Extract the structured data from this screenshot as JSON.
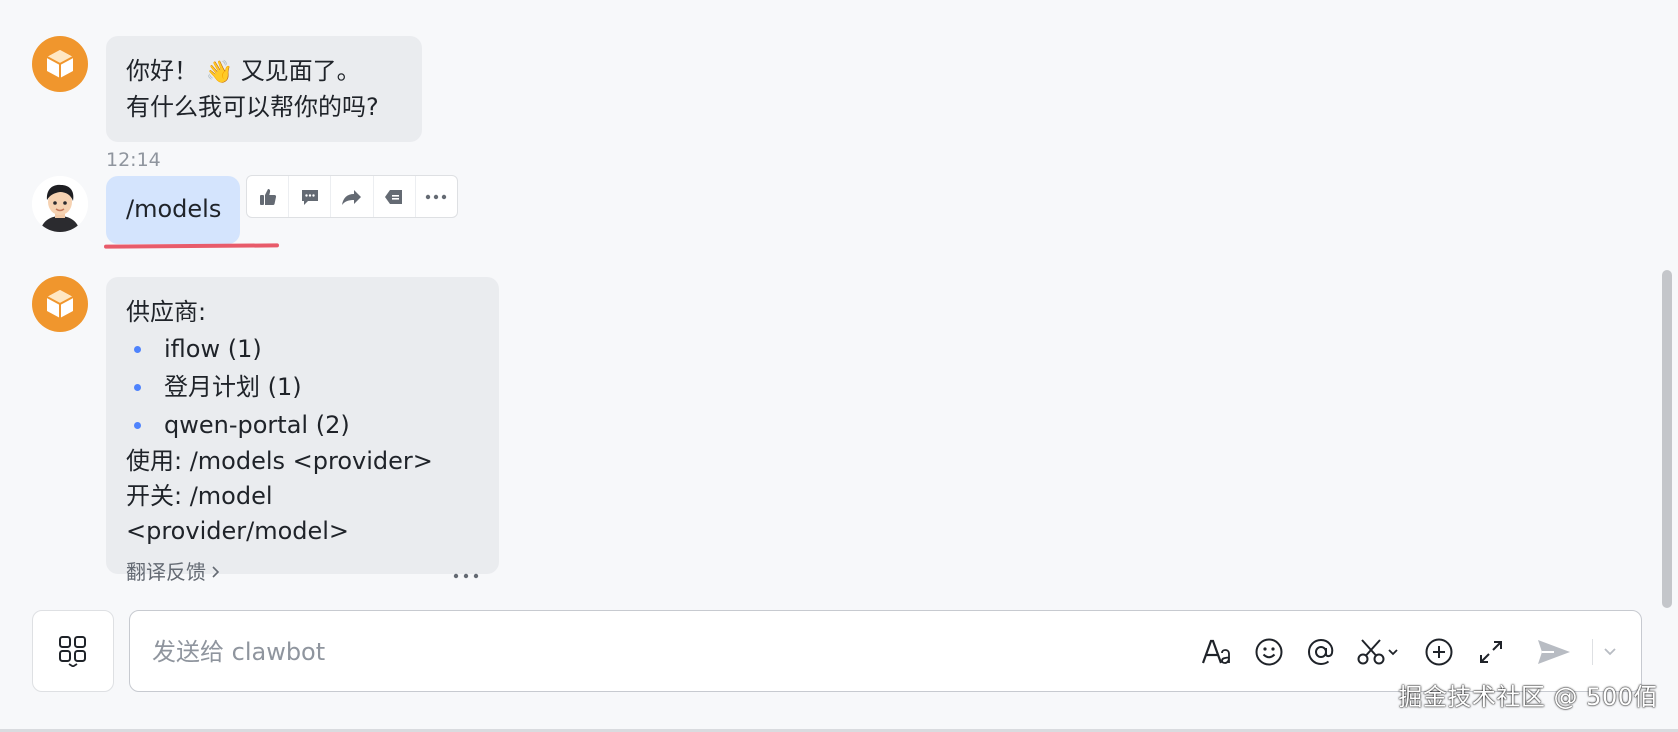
{
  "messages": {
    "greeting": {
      "line1_prefix": "你好！",
      "wave_emoji": "👋",
      "line1_suffix": "又见面了。",
      "line2": "有什么我可以帮你的吗?"
    },
    "user_message": {
      "time": "12:14",
      "text": "/models"
    },
    "reply": {
      "heading": "供应商:",
      "providers": [
        "iflow (1)",
        "登月计划 (1)",
        "qwen-portal (2)"
      ],
      "usage_line": "使用: /models <provider>",
      "switch_line": "开关: /model <provider/model>",
      "translate_feedback": "翻译反馈",
      "more_glyph": "···"
    }
  },
  "composer": {
    "placeholder": "发送给 clawbot"
  },
  "watermark": "掘金技术社区 @ 500佰",
  "colors": {
    "bot_avatar": "#f0962d",
    "bot_bubble": "#eaecef",
    "user_bubble": "#d4e4fd",
    "accent": "#4e83fd",
    "underline": "#e85b6a"
  }
}
